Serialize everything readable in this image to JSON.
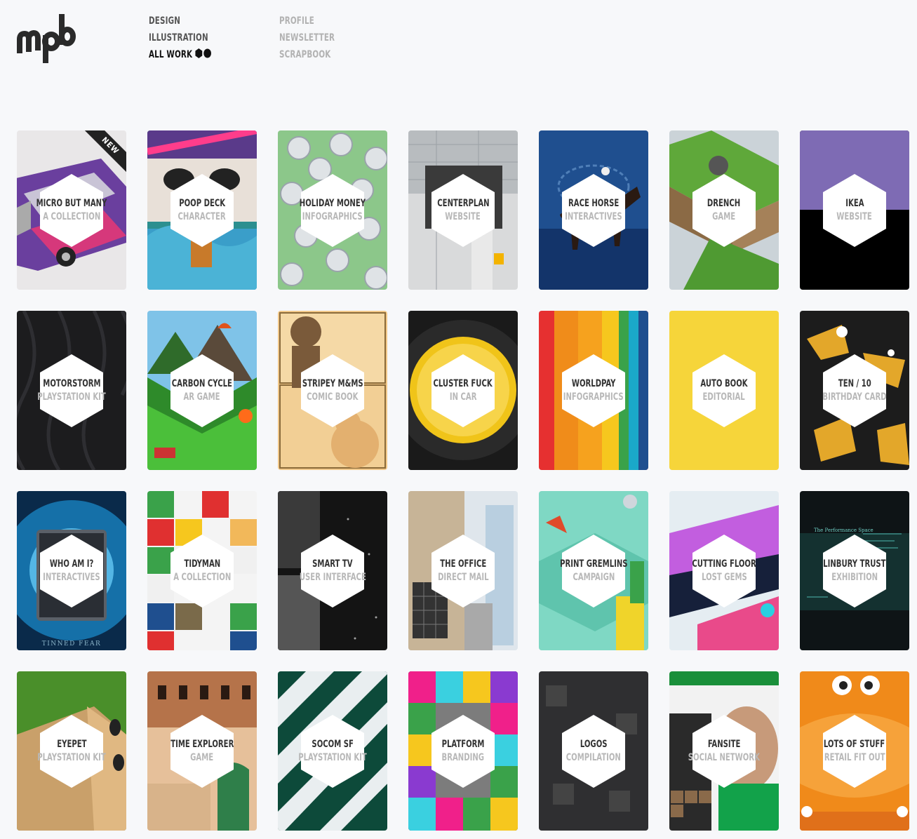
{
  "brand": {
    "logo_text": "mpb"
  },
  "nav": {
    "primary": [
      {
        "label": "DESIGN",
        "active": false
      },
      {
        "label": "ILLUSTRATION",
        "active": false
      },
      {
        "label": "ALL WORK",
        "active": true
      }
    ],
    "secondary": [
      {
        "label": "PROFILE"
      },
      {
        "label": "NEWSLETTER"
      },
      {
        "label": "SCRAPBOOK"
      }
    ]
  },
  "badges": {
    "new": "NEW",
    "tinned_fear": "TINNED FEAR"
  },
  "projects": [
    {
      "title": "MICRO BUT MANY",
      "subtitle": "A COLLECTION",
      "art": "car",
      "badge": "NEW"
    },
    {
      "title": "POOP DECK",
      "subtitle": "CHARACTER",
      "art": "poop"
    },
    {
      "title": "HOLIDAY MONEY",
      "subtitle": "INFOGRAPHICS",
      "art": "money"
    },
    {
      "title": "CENTERPLAN",
      "subtitle": "WEBSITE",
      "art": "centerplan"
    },
    {
      "title": "RACE HORSE",
      "subtitle": "INTERACTIVES",
      "art": "horse"
    },
    {
      "title": "DRENCH",
      "subtitle": "GAME",
      "art": "drench"
    },
    {
      "title": "IKEA",
      "subtitle": "WEBSITE",
      "art": "ikea"
    },
    {
      "title": "MOTORSTORM",
      "subtitle": "PLAYSTATION KIT",
      "art": "tyre"
    },
    {
      "title": "CARBON CYCLE",
      "subtitle": "AR GAME",
      "art": "carbon"
    },
    {
      "title": "STRIPEY M&MS",
      "subtitle": "COMIC BOOK",
      "art": "comic"
    },
    {
      "title": "CLUSTER FUCK",
      "subtitle": "IN CAR",
      "art": "cluster"
    },
    {
      "title": "WORLDPAY",
      "subtitle": "INFOGRAPHICS",
      "art": "worldpay"
    },
    {
      "title": "AUTO BOOK",
      "subtitle": "EDITORIAL",
      "art": "autobook"
    },
    {
      "title": "TEN / 10",
      "subtitle": "BIRTHDAY CARD",
      "art": "tenten"
    },
    {
      "title": "WHO AM I?",
      "subtitle": "INTERACTIVES",
      "art": "tin",
      "caption": "TINNED FEAR"
    },
    {
      "title": "TIDYMAN",
      "subtitle": "A COLLECTION",
      "art": "tidyman"
    },
    {
      "title": "SMART TV",
      "subtitle": "USER INTERFACE",
      "art": "smarttv"
    },
    {
      "title": "THE OFFICE",
      "subtitle": "DIRECT MAIL",
      "art": "office"
    },
    {
      "title": "PRINT GREMLINS",
      "subtitle": "CAMPAIGN",
      "art": "gremlins"
    },
    {
      "title": "CUTTING FLOOR",
      "subtitle": "LOST GEMS",
      "art": "cutting"
    },
    {
      "title": "LINBURY TRUST",
      "subtitle": "EXHIBITION",
      "art": "linbury"
    },
    {
      "title": "EYEPET",
      "subtitle": "PLAYSTATION KIT",
      "art": "eyepet"
    },
    {
      "title": "TIME EXPLORER",
      "subtitle": "GAME",
      "art": "time"
    },
    {
      "title": "SOCOM SF",
      "subtitle": "PLAYSTATION KIT",
      "art": "socom"
    },
    {
      "title": "PLATFORM",
      "subtitle": "BRANDING",
      "art": "platform"
    },
    {
      "title": "LOGOS",
      "subtitle": "COMPILATION",
      "art": "logos"
    },
    {
      "title": "FANSITE",
      "subtitle": "SOCIAL NETWORK",
      "art": "fansite"
    },
    {
      "title": "LOTS OF STUFF",
      "subtitle": "RETAIL FIT OUT",
      "art": "stuff"
    }
  ]
}
